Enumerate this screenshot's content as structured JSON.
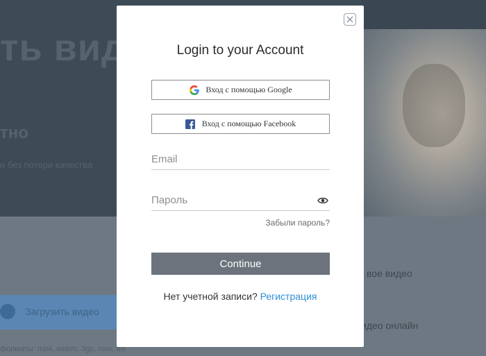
{
  "background": {
    "headline": "ть вид",
    "subheading": "тно",
    "description": "н без потери качества",
    "upload_label": "Загрузить видео",
    "formats": "форматы: mp4, webm, 3gp, mov, avi",
    "feature_1": "вое видео",
    "feature_2": "идео онлайн"
  },
  "modal": {
    "title": "Login to your Account",
    "google_label": "Вход с помощью Google",
    "facebook_label": "Вход с помощью Facebook",
    "email_placeholder": "Email",
    "password_placeholder": "Пароль",
    "forgot_label": "Забыли пароль?",
    "continue_label": "Continue",
    "no_account_text": "Нет учетной записи?",
    "register_label": "Регистрация"
  },
  "colors": {
    "overlay": "#6d7883",
    "button_primary": "#6c737c",
    "link": "#2a8fd6",
    "facebook_blue": "#3b5998"
  },
  "icons": [
    "close-icon",
    "google-icon",
    "facebook-icon",
    "eye-icon",
    "upload-cloud-icon"
  ]
}
